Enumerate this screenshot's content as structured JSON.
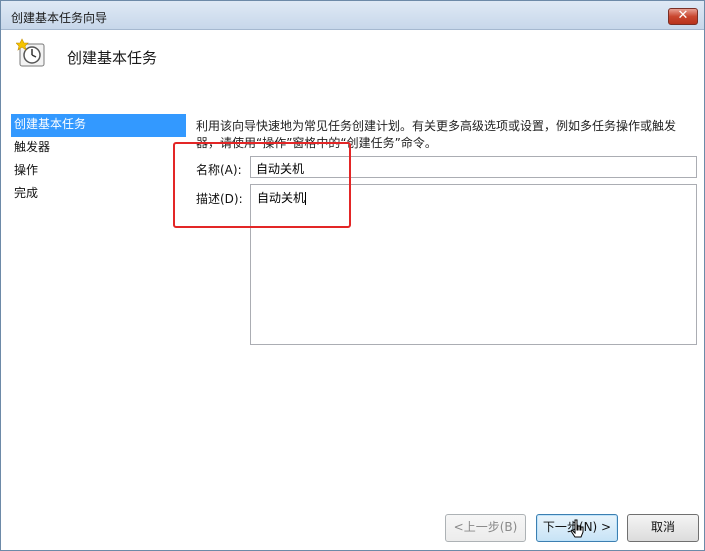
{
  "window": {
    "title": "创建基本任务向导",
    "close_glyph": "✕"
  },
  "header": {
    "title": "创建基本任务",
    "icon": "task-clock-icon"
  },
  "nav": {
    "items": [
      "创建基本任务",
      "触发器",
      "操作",
      "完成"
    ]
  },
  "content": {
    "description": "利用该向导快速地为常见任务创建计划。有关更多高级选项或设置，例如多任务操作或触发器，请使用“操作”窗格中的“创建任务”命令。",
    "name_label": "名称(A):",
    "name_value": "自动关机",
    "desc_label": "描述(D):",
    "desc_value": "自动关机"
  },
  "buttons": {
    "back": "<上一步(B)",
    "next": "下一步(N) >",
    "cancel": "取消"
  },
  "colors": {
    "accent": "#3399ff",
    "highlight": "#e32626",
    "close": "#c9462f"
  }
}
